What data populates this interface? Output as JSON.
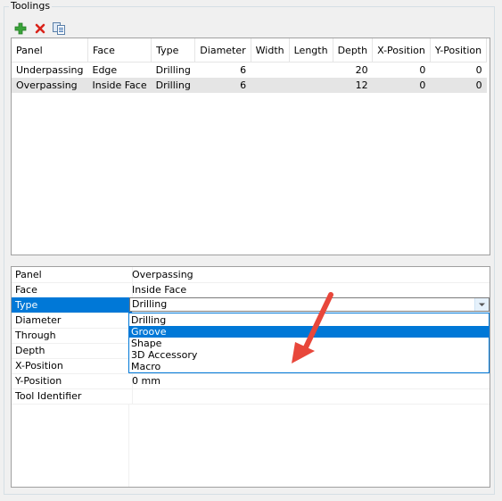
{
  "group": {
    "title": "Toolings"
  },
  "toolbar": [
    {
      "icon": "add-icon"
    },
    {
      "icon": "delete-icon"
    },
    {
      "icon": "copy-icon"
    }
  ],
  "grid": {
    "columns": [
      "Panel",
      "Face",
      "Type",
      "Diameter",
      "Width",
      "Length",
      "Depth",
      "X-Position",
      "Y-Position"
    ],
    "rows": [
      [
        "Underpassing",
        "Edge",
        "Drilling",
        "6",
        "",
        "",
        "20",
        "0",
        "0"
      ],
      [
        "Overpassing",
        "Inside Face",
        "Drilling",
        "6",
        "",
        "",
        "12",
        "0",
        "0"
      ]
    ],
    "selected_row": 1
  },
  "properties": [
    {
      "name": "Panel",
      "value": "Overpassing"
    },
    {
      "name": "Face",
      "value": "Inside Face"
    },
    {
      "name": "Type",
      "value": "Drilling"
    },
    {
      "name": "Diameter",
      "value": ""
    },
    {
      "name": "Through",
      "value": ""
    },
    {
      "name": "Depth",
      "value": ""
    },
    {
      "name": "X-Position",
      "value": ""
    },
    {
      "name": "Y-Position",
      "value": "0 mm"
    },
    {
      "name": "Tool Identifier",
      "value": ""
    }
  ],
  "dropdown": {
    "options": [
      "Drilling",
      "Groove",
      "Shape",
      "3D Accessory",
      "Macro"
    ],
    "highlighted": "Groove"
  },
  "colors": {
    "selection": "#0078d7",
    "arrow": "#e8473b",
    "add": "#3aa33a",
    "delete": "#d9231a"
  }
}
